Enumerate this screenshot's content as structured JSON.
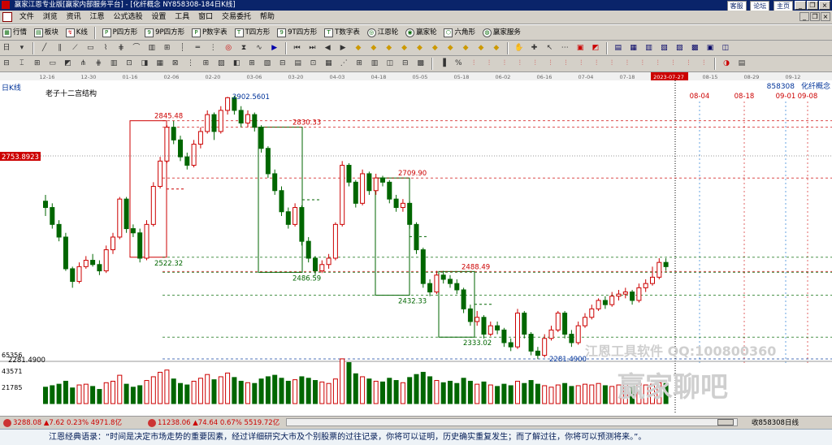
{
  "window": {
    "title": "赢家江恩专业版[赢家内部服务平台] - [化纤概念  NY858308-184日K线]",
    "links": [
      "客服",
      "论坛",
      "主页"
    ]
  },
  "menu": [
    "文件",
    "浏览",
    "资讯",
    "江恩",
    "公式选股",
    "设置",
    "工具",
    "窗口",
    "交易委托",
    "帮助"
  ],
  "toolbar1": [
    {
      "icon": "grid-icon",
      "label": "行情"
    },
    {
      "icon": "blocks-icon",
      "label": "板块"
    },
    {
      "icon": "kline-icon",
      "label": "K线"
    },
    {
      "icon": "p-square-icon",
      "label": "P四方形"
    },
    {
      "icon": "9p-square-icon",
      "label": "9P四方形"
    },
    {
      "icon": "p-number-icon",
      "label": "P数字表"
    },
    {
      "icon": "t-square-icon",
      "label": "T四方形"
    },
    {
      "icon": "9t-square-icon",
      "label": "9T四方形"
    },
    {
      "icon": "t-number-icon",
      "label": "T数字表"
    },
    {
      "icon": "gann-wheel-icon",
      "label": "江恩轮"
    },
    {
      "icon": "winner-wheel-icon",
      "label": "赢家轮"
    },
    {
      "icon": "hexagon-icon",
      "label": "六角形"
    },
    {
      "icon": "service-icon",
      "label": "赢家服务"
    }
  ],
  "chart": {
    "period_label": "日K线",
    "structure_title": "老子十二宫结构",
    "code": "858308",
    "name": "化纤概念",
    "cursor_date": "2023-07-27",
    "top_dates": [
      "12-16",
      "12-30",
      "01-16",
      "02-06",
      "02-20",
      "03-06",
      "03-20",
      "04-03",
      "04-18",
      "05-05",
      "05-18",
      "06-02",
      "06-16",
      "07-04",
      "07-18",
      "2023-07-27",
      "08-15",
      "08-29",
      "09-12"
    ],
    "future_dates": [
      "08-04",
      "08-18",
      "09-01",
      "09-08"
    ],
    "y_marker": "2753.8923",
    "price_labels": [
      {
        "text": "2845.48",
        "color": "#c00"
      },
      {
        "text": "2902.5601",
        "color": "#003399"
      },
      {
        "text": "2830.33",
        "color": "#c00"
      },
      {
        "text": "2709.90",
        "color": "#c00"
      },
      {
        "text": "2522.32",
        "color": "#060"
      },
      {
        "text": "2486.59",
        "color": "#060"
      },
      {
        "text": "2488.49",
        "color": "#c00"
      },
      {
        "text": "2432.33",
        "color": "#060"
      },
      {
        "text": "2333.02",
        "color": "#060"
      },
      {
        "text": "2281.4900",
        "color": "#003399"
      }
    ],
    "bottom_price": "2281.4900",
    "volume_scale": [
      "65356",
      "43571",
      "21785"
    ],
    "watermark_tool": "江恩工具软件  QQ:100800360",
    "watermark_brand": "赢家聊吧"
  },
  "chart_data": {
    "type": "candlestick",
    "ylim": [
      2281.49,
      2902.5601
    ],
    "candles": [
      [
        2655,
        2640,
        2670,
        2620
      ],
      [
        2640,
        2600,
        2650,
        2590
      ],
      [
        2600,
        2570,
        2610,
        2560
      ],
      [
        2570,
        2495,
        2580,
        2490
      ],
      [
        2495,
        2465,
        2500,
        2450
      ],
      [
        2465,
        2500,
        2510,
        2460
      ],
      [
        2500,
        2515,
        2525,
        2495
      ],
      [
        2515,
        2505,
        2530,
        2500
      ],
      [
        2505,
        2490,
        2515,
        2480
      ],
      [
        2490,
        2540,
        2550,
        2485
      ],
      [
        2540,
        2570,
        2580,
        2530
      ],
      [
        2570,
        2660,
        2665,
        2565
      ],
      [
        2660,
        2590,
        2665,
        2580
      ],
      [
        2590,
        2580,
        2600,
        2570
      ],
      [
        2580,
        2520,
        2590,
        2510
      ],
      [
        2520,
        2600,
        2610,
        2515
      ],
      [
        2600,
        2690,
        2700,
        2595
      ],
      [
        2690,
        2750,
        2760,
        2685
      ],
      [
        2750,
        2830,
        2835,
        2745
      ],
      [
        2830,
        2800,
        2845,
        2790
      ],
      [
        2800,
        2760,
        2810,
        2750
      ],
      [
        2760,
        2740,
        2770,
        2730
      ],
      [
        2740,
        2790,
        2800,
        2735
      ],
      [
        2790,
        2820,
        2830,
        2780
      ],
      [
        2820,
        2860,
        2870,
        2815
      ],
      [
        2860,
        2820,
        2865,
        2800
      ],
      [
        2820,
        2870,
        2880,
        2815
      ],
      [
        2870,
        2900,
        2902,
        2860
      ],
      [
        2900,
        2870,
        2905,
        2860
      ],
      [
        2870,
        2840,
        2880,
        2830
      ],
      [
        2840,
        2860,
        2870,
        2830
      ],
      [
        2860,
        2830,
        2865,
        2820
      ],
      [
        2830,
        2780,
        2835,
        2770
      ],
      [
        2780,
        2720,
        2785,
        2710
      ],
      [
        2720,
        2680,
        2730,
        2670
      ],
      [
        2680,
        2630,
        2690,
        2620
      ],
      [
        2630,
        2600,
        2640,
        2590
      ],
      [
        2600,
        2640,
        2650,
        2595
      ],
      [
        2640,
        2560,
        2645,
        2550
      ],
      [
        2560,
        2520,
        2570,
        2510
      ],
      [
        2520,
        2490,
        2525,
        2480
      ],
      [
        2490,
        2505,
        2515,
        2485
      ],
      [
        2505,
        2520,
        2530,
        2495
      ],
      [
        2520,
        2600,
        2605,
        2515
      ],
      [
        2600,
        2740,
        2750,
        2595
      ],
      [
        2740,
        2700,
        2745,
        2690
      ],
      [
        2700,
        2650,
        2705,
        2640
      ],
      [
        2650,
        2720,
        2730,
        2645
      ],
      [
        2720,
        2680,
        2725,
        2670
      ],
      [
        2680,
        2710,
        2720,
        2670
      ],
      [
        2710,
        2700,
        2715,
        2690
      ],
      [
        2700,
        2660,
        2705,
        2650
      ],
      [
        2660,
        2640,
        2670,
        2630
      ],
      [
        2640,
        2650,
        2660,
        2630
      ],
      [
        2650,
        2600,
        2655,
        2590
      ],
      [
        2600,
        2540,
        2605,
        2530
      ],
      [
        2540,
        2460,
        2545,
        2450
      ],
      [
        2460,
        2440,
        2470,
        2430
      ],
      [
        2440,
        2480,
        2490,
        2435
      ],
      [
        2480,
        2470,
        2490,
        2460
      ],
      [
        2470,
        2460,
        2480,
        2450
      ],
      [
        2460,
        2445,
        2470,
        2435
      ],
      [
        2445,
        2400,
        2450,
        2390
      ],
      [
        2400,
        2370,
        2410,
        2360
      ],
      [
        2370,
        2380,
        2395,
        2360
      ],
      [
        2380,
        2340,
        2385,
        2330
      ],
      [
        2340,
        2360,
        2370,
        2335
      ],
      [
        2360,
        2350,
        2370,
        2340
      ],
      [
        2350,
        2320,
        2355,
        2310
      ],
      [
        2320,
        2310,
        2330,
        2300
      ],
      [
        2310,
        2390,
        2400,
        2305
      ],
      [
        2390,
        2340,
        2395,
        2330
      ],
      [
        2340,
        2300,
        2345,
        2290
      ],
      [
        2300,
        2290,
        2310,
        2281
      ],
      [
        2290,
        2330,
        2340,
        2285
      ],
      [
        2330,
        2350,
        2360,
        2325
      ],
      [
        2350,
        2390,
        2395,
        2345
      ],
      [
        2390,
        2340,
        2395,
        2330
      ],
      [
        2340,
        2320,
        2350,
        2310
      ],
      [
        2320,
        2360,
        2370,
        2315
      ],
      [
        2360,
        2380,
        2390,
        2355
      ],
      [
        2380,
        2400,
        2410,
        2375
      ],
      [
        2400,
        2420,
        2425,
        2395
      ],
      [
        2420,
        2410,
        2430,
        2400
      ],
      [
        2410,
        2430,
        2440,
        2405
      ],
      [
        2430,
        2435,
        2445,
        2420
      ],
      [
        2435,
        2440,
        2450,
        2425
      ],
      [
        2440,
        2420,
        2445,
        2410
      ],
      [
        2420,
        2450,
        2460,
        2415
      ],
      [
        2450,
        2460,
        2470,
        2440
      ],
      [
        2460,
        2475,
        2500,
        2455
      ],
      [
        2475,
        2510,
        2520,
        2470
      ],
      [
        2510,
        2500,
        2520,
        2490
      ]
    ],
    "volume_ylim": [
      0,
      87141
    ],
    "volumes": [
      22000,
      24000,
      26000,
      30000,
      21000,
      25000,
      26000,
      23000,
      19000,
      28000,
      30000,
      38000,
      26000,
      22000,
      24000,
      31000,
      36000,
      42000,
      45000,
      33000,
      27000,
      25000,
      30000,
      34000,
      39000,
      32000,
      36000,
      41000,
      35000,
      30000,
      28000,
      27000,
      33000,
      36000,
      38000,
      34000,
      30000,
      32000,
      36000,
      34000,
      31000,
      29000,
      27000,
      33000,
      60000,
      55000,
      40000,
      36000,
      33000,
      30000,
      29000,
      34000,
      31000,
      28000,
      35000,
      39000,
      42000,
      36000,
      31000,
      28000,
      30000,
      27000,
      34000,
      30000,
      26000,
      29000,
      25000,
      23000,
      26000,
      24000,
      30000,
      27000,
      31000,
      26000,
      24000,
      22000,
      25000,
      27000,
      23000,
      24000,
      26000,
      25000,
      27000,
      24000,
      23000,
      25000,
      26000,
      24000,
      27000,
      25000,
      26000,
      28000,
      27000
    ],
    "levels": [
      {
        "value": 2845.48,
        "color": "#c00"
      },
      {
        "value": 2830.33,
        "color": "#c00"
      },
      {
        "value": 2709.9,
        "color": "#c00"
      },
      {
        "value": 2522.32,
        "color": "#060"
      },
      {
        "value": 2488.49,
        "color": "#c00"
      },
      {
        "value": 2486.59,
        "color": "#060"
      },
      {
        "value": 2432.33,
        "color": "#060"
      },
      {
        "value": 2333.02,
        "color": "#060"
      },
      {
        "value": 2281.49,
        "color": "#003399"
      }
    ]
  },
  "status": {
    "seg1": "3288.08 ▲7.62 0.23% 4971.8亿",
    "seg2": "11238.06 ▲74.64 0.67% 5519.72亿",
    "right": "收858308日线"
  },
  "quote": "江恩经典语录：“时间是决定市场走势的重要因素，经过详细研究大市及个别股票的过往记录，你将可以证明，历史确实重复发生；而了解过往，你将可以预测将来。”。",
  "colors": {
    "up": "#c00",
    "down": "#060",
    "box_up": "#c00",
    "box_down": "#060"
  }
}
